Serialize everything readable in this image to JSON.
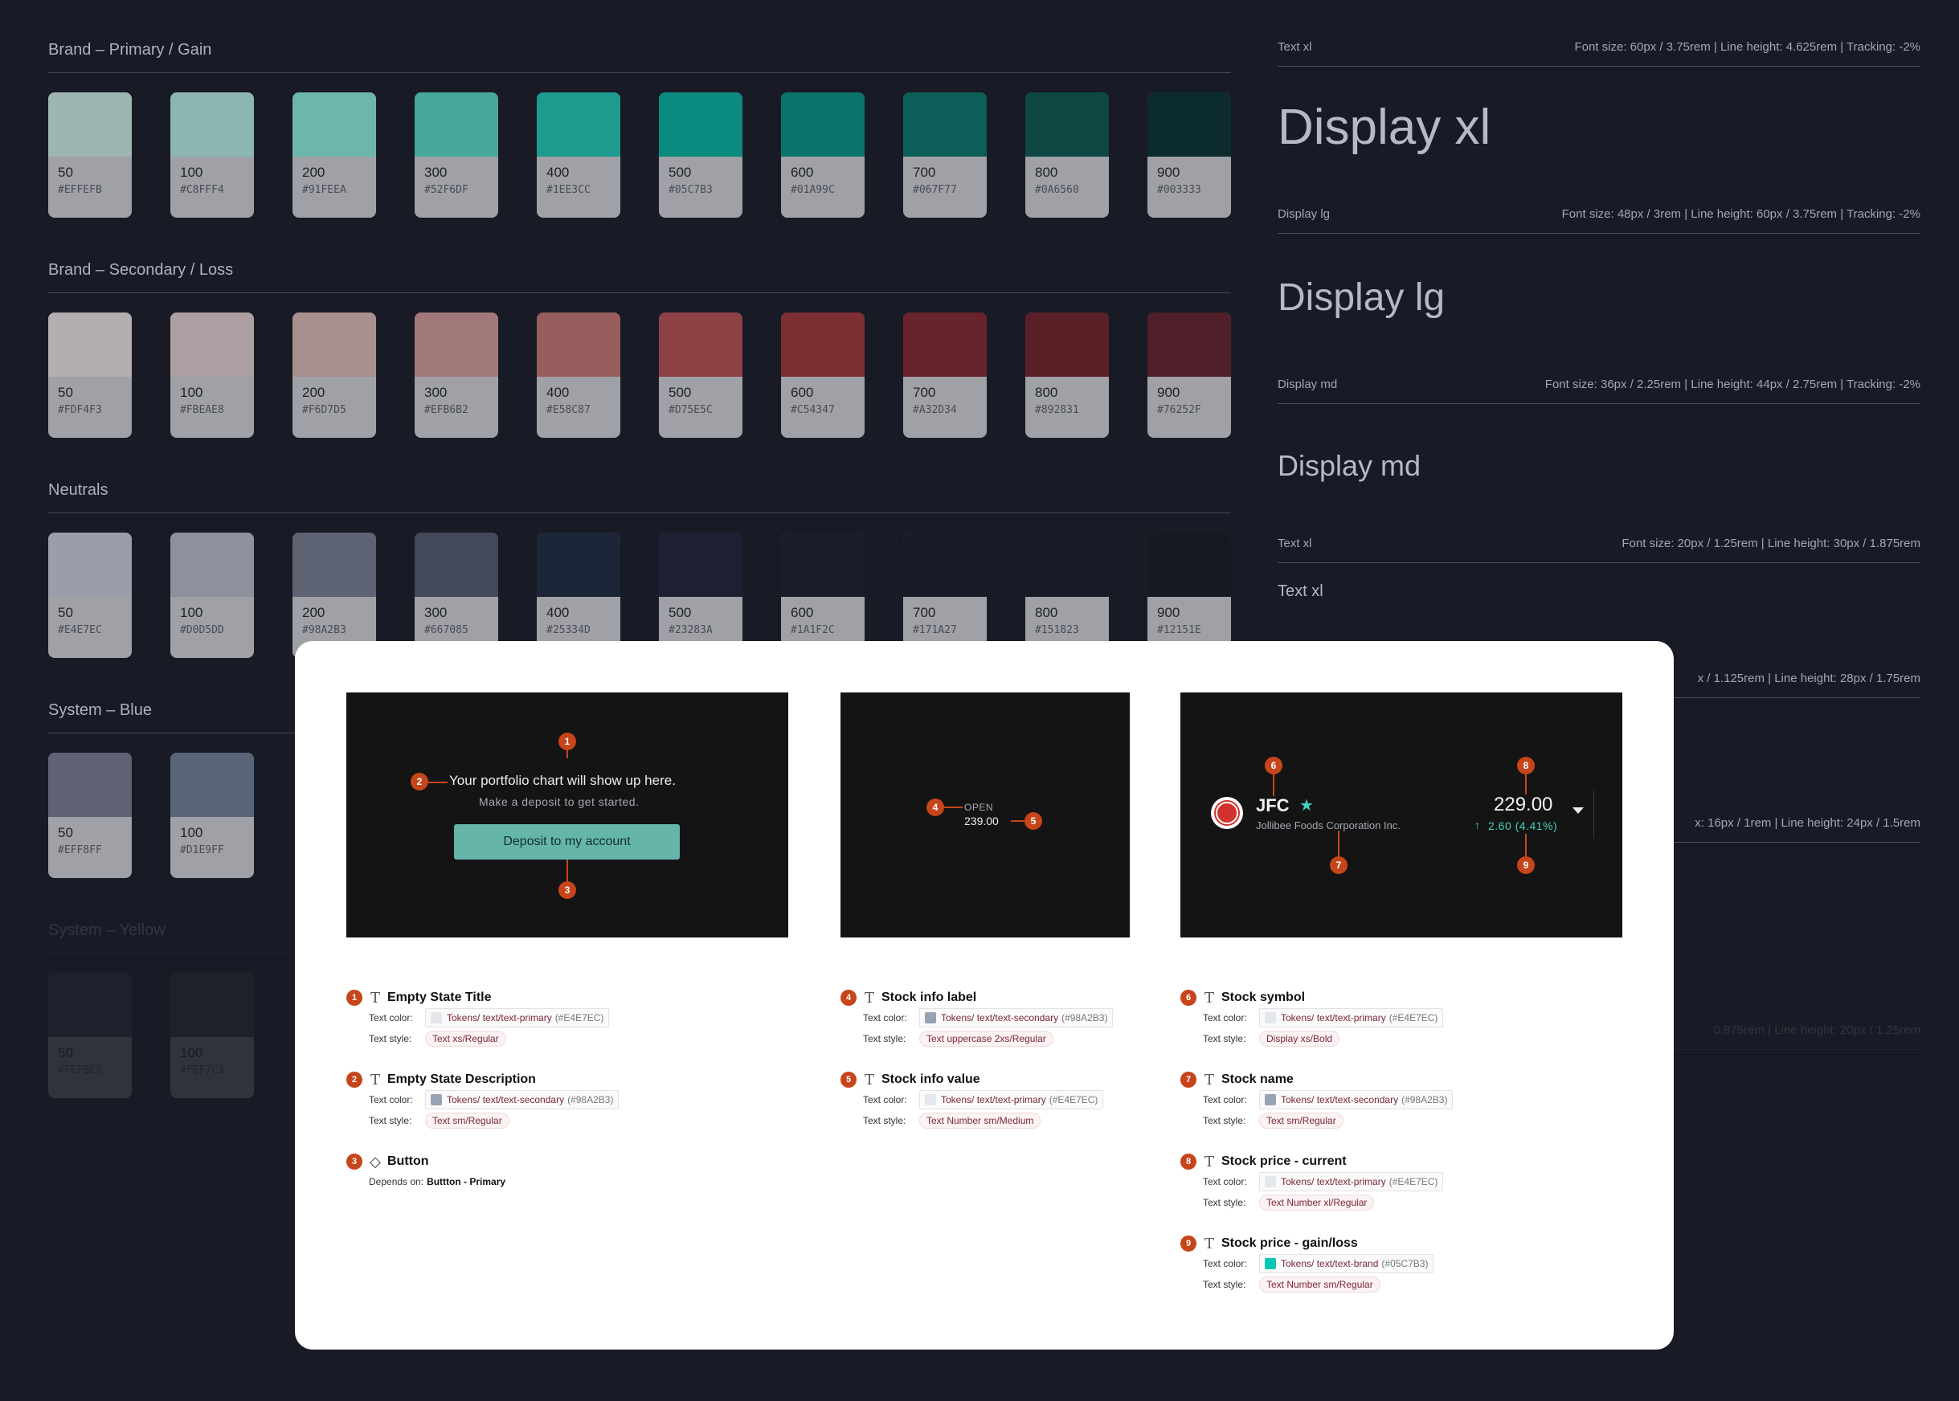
{
  "palettes": [
    {
      "title": "Brand – Primary / Gain",
      "swatches": [
        {
          "step": "50",
          "hex": "#EFFEFB",
          "chip": "#9fb5b1"
        },
        {
          "step": "100",
          "hex": "#C8FFF4",
          "chip": "#8cb6b2"
        },
        {
          "step": "200",
          "hex": "#91FEEA",
          "chip": "#6cb6ac"
        },
        {
          "step": "300",
          "hex": "#52F6DF",
          "chip": "#45a89a"
        },
        {
          "step": "400",
          "hex": "#1EE3CC",
          "chip": "#1d9b8e"
        },
        {
          "step": "500",
          "hex": "#05C7B3",
          "chip": "#0b8a7f"
        },
        {
          "step": "600",
          "hex": "#01A99C",
          "chip": "#0b746d"
        },
        {
          "step": "700",
          "hex": "#067F77",
          "chip": "#0d5d58"
        },
        {
          "step": "800",
          "hex": "#0A6560",
          "chip": "#0f4745"
        },
        {
          "step": "900",
          "hex": "#003333",
          "chip": "#0b2b2c"
        }
      ]
    },
    {
      "title": "Brand – Secondary / Loss",
      "swatches": [
        {
          "step": "50",
          "hex": "#FDF4F3",
          "chip": "#b3aeb1"
        },
        {
          "step": "100",
          "hex": "#FBEAE8",
          "chip": "#ae9fa3"
        },
        {
          "step": "200",
          "hex": "#F6D7D5",
          "chip": "#a8908f"
        },
        {
          "step": "300",
          "hex": "#EFB6B2",
          "chip": "#a2797a"
        },
        {
          "step": "400",
          "hex": "#E58C87",
          "chip": "#985d5d"
        },
        {
          "step": "500",
          "hex": "#D75E5C",
          "chip": "#8c4144"
        },
        {
          "step": "600",
          "hex": "#C54347",
          "chip": "#7c2e33"
        },
        {
          "step": "700",
          "hex": "#A32D34",
          "chip": "#68232b"
        },
        {
          "step": "800",
          "hex": "#892831",
          "chip": "#5b1f28"
        },
        {
          "step": "900",
          "hex": "#76252F",
          "chip": "#501f29"
        }
      ]
    },
    {
      "title": "Neutrals",
      "swatches": [
        {
          "step": "50",
          "hex": "#E4E7EC",
          "chip": "#9b9ea8"
        },
        {
          "step": "100",
          "hex": "#D0D5DD",
          "chip": "#8d919c"
        },
        {
          "step": "200",
          "hex": "#98A2B3",
          "chip": "#5d6372"
        },
        {
          "step": "300",
          "hex": "#667085",
          "chip": "#444959"
        },
        {
          "step": "400",
          "hex": "#25334D",
          "chip": "#1c2638"
        },
        {
          "step": "500",
          "hex": "#23283A",
          "chip": "#1d2030"
        },
        {
          "step": "600",
          "hex": "#1A1F2C",
          "chip": "#1a1d29"
        },
        {
          "step": "700",
          "hex": "#171A27",
          "chip": "#191b27"
        },
        {
          "step": "800",
          "hex": "#151823",
          "chip": "#181a25"
        },
        {
          "step": "900",
          "hex": "#12151E",
          "chip": "#161822"
        }
      ]
    },
    {
      "title": "System – Blue",
      "swatches": [
        {
          "step": "50",
          "hex": "#EFF8FF",
          "chip": "#5e6273"
        },
        {
          "step": "100",
          "hex": "#D1E9FF",
          "chip": "#5a6478"
        }
      ]
    },
    {
      "title": "System – Yellow",
      "swatches": [
        {
          "step": "50",
          "hex": "#FEFBE8",
          "chip": "#3a3c46"
        },
        {
          "step": "100",
          "hex": "#FEF7C3",
          "chip": "#3a3b42"
        }
      ]
    }
  ],
  "type_specs": [
    {
      "name": "Text xl",
      "spec": "Font size: 60px / 3.75rem | Line height: 4.625rem | Tracking: -2%",
      "sample": "Display xl"
    },
    {
      "name": "Display lg",
      "spec": "Font size: 48px / 3rem | Line height: 60px / 3.75rem | Tracking: -2%",
      "sample": "Display lg"
    },
    {
      "name": "Display md",
      "spec": "Font size: 36px / 2.25rem | Line height: 44px / 2.75rem | Tracking: -2%",
      "sample": "Display md"
    },
    {
      "name": "Text xl",
      "spec": "Font size: 20px / 1.25rem | Line height: 30px / 1.875rem",
      "sample": "Text xl"
    },
    {
      "name": "",
      "spec": "x / 1.125rem | Line height: 28px / 1.75rem",
      "sample": ""
    },
    {
      "name": "",
      "spec": "x: 16px / 1rem | Line height: 24px / 1.5rem",
      "sample": ""
    },
    {
      "name": "",
      "spec": "0.875rem | Line height: 20px / 1.25rem",
      "sample": ""
    }
  ],
  "frames": {
    "empty_state": {
      "title": "Your portfolio chart will show up here.",
      "description": "Make a deposit to get started.",
      "button": "Deposit to my account"
    },
    "stock_info": {
      "label": "OPEN",
      "value": "239.00"
    },
    "stock_header": {
      "symbol": "JFC",
      "name": "Jollibee Foods Corporation Inc.",
      "price": "229.00",
      "change": "2.60 (4.41%)",
      "gain_color": "#05C7B3"
    }
  },
  "markers": [
    "1",
    "2",
    "3",
    "4",
    "5",
    "6",
    "7",
    "8",
    "9"
  ],
  "annotations": {
    "col1": [
      {
        "n": "1",
        "kind": "text",
        "title": "Empty State Title",
        "color_label": "Text color:",
        "token": "Tokens/ text/text-primary",
        "hex": "(#E4E7EC)",
        "swatch": "#E4E7EC",
        "style_label": "Text style:",
        "style": "Text xs/Regular"
      },
      {
        "n": "2",
        "kind": "text",
        "title": "Empty State Description",
        "color_label": "Text color:",
        "token": "Tokens/ text/text-secondary",
        "hex": "(#98A2B3)",
        "swatch": "#98A2B3",
        "style_label": "Text style:",
        "style": "Text sm/Regular"
      },
      {
        "n": "3",
        "kind": "component",
        "title": "Button",
        "dep_label": "Depends on:",
        "dep": "Buttton - Primary"
      }
    ],
    "col2": [
      {
        "n": "4",
        "kind": "text",
        "title": "Stock info label",
        "color_label": "Text color:",
        "token": "Tokens/ text/text-secondary",
        "hex": "(#98A2B3)",
        "swatch": "#98A2B3",
        "style_label": "Text style:",
        "style": "Text uppercase 2xs/Regular"
      },
      {
        "n": "5",
        "kind": "text",
        "title": "Stock info value",
        "color_label": "Text color:",
        "token": "Tokens/ text/text-primary",
        "hex": "(#E4E7EC)",
        "swatch": "#E4E7EC",
        "style_label": "Text style:",
        "style": "Text Number sm/Medium"
      }
    ],
    "col3": [
      {
        "n": "6",
        "kind": "text",
        "title": "Stock symbol",
        "color_label": "Text color:",
        "token": "Tokens/ text/text-primary",
        "hex": "(#E4E7EC)",
        "swatch": "#E4E7EC",
        "style_label": "Text style:",
        "style": "Display xs/Bold"
      },
      {
        "n": "7",
        "kind": "text",
        "title": "Stock name",
        "color_label": "Text color:",
        "token": "Tokens/ text/text-secondary",
        "hex": "(#98A2B3)",
        "swatch": "#98A2B3",
        "style_label": "Text style:",
        "style": "Text sm/Regular"
      },
      {
        "n": "8",
        "kind": "text",
        "title": "Stock price - current",
        "color_label": "Text color:",
        "token": "Tokens/ text/text-primary",
        "hex": "(#E4E7EC)",
        "swatch": "#E4E7EC",
        "style_label": "Text style:",
        "style": "Text Number xl/Regular"
      },
      {
        "n": "9",
        "kind": "text",
        "title": "Stock price - gain/loss",
        "color_label": "Text color:",
        "token": "Tokens/ text/text-brand",
        "hex": "(#05C7B3)",
        "swatch": "#05C7B3",
        "style_label": "Text style:",
        "style": "Text Number sm/Regular"
      }
    ]
  }
}
